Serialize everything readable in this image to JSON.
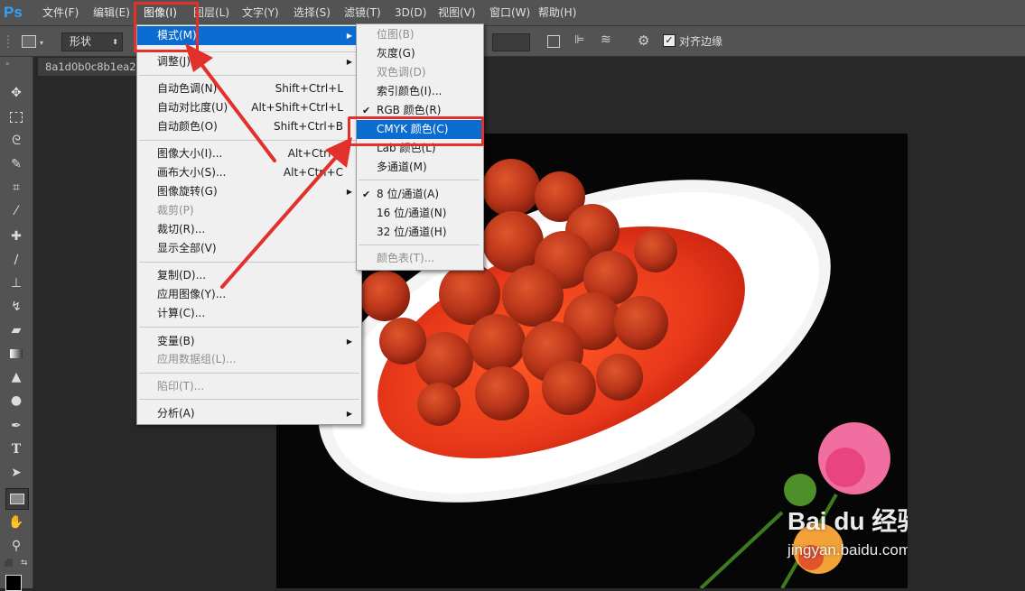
{
  "app": {
    "logo": "Ps"
  },
  "menubar": [
    "文件(F)",
    "编辑(E)",
    "图像(I)",
    "图层(L)",
    "文字(Y)",
    "选择(S)",
    "滤镜(T)",
    "3D(D)",
    "视图(V)",
    "窗口(W)",
    "帮助(H)"
  ],
  "options_bar": {
    "shape_mode": "形状",
    "align_edges_label": "对齐边缘",
    "align_edges_checked": true
  },
  "document_tab": {
    "title": "8a1d0b0c8b1ea24"
  },
  "image_menu": {
    "items": [
      {
        "label": "模式(M)",
        "shortcut": "",
        "submenu": true,
        "disabled": false,
        "highlighted": true
      },
      {
        "label": "调整(J)",
        "shortcut": "",
        "submenu": true,
        "disabled": false
      },
      {
        "label": "自动色调(N)",
        "shortcut": "Shift+Ctrl+L",
        "disabled": false
      },
      {
        "label": "自动对比度(U)",
        "shortcut": "Alt+Shift+Ctrl+L",
        "disabled": false
      },
      {
        "label": "自动颜色(O)",
        "shortcut": "Shift+Ctrl+B",
        "disabled": false
      },
      {
        "label": "图像大小(I)...",
        "shortcut": "Alt+Ctrl+I",
        "disabled": false
      },
      {
        "label": "画布大小(S)...",
        "shortcut": "Alt+Ctrl+C",
        "disabled": false
      },
      {
        "label": "图像旋转(G)",
        "shortcut": "",
        "submenu": true,
        "disabled": false
      },
      {
        "label": "裁剪(P)",
        "shortcut": "",
        "disabled": true
      },
      {
        "label": "裁切(R)...",
        "shortcut": "",
        "disabled": false
      },
      {
        "label": "显示全部(V)",
        "shortcut": "",
        "disabled": false
      },
      {
        "label": "复制(D)...",
        "shortcut": "",
        "disabled": false
      },
      {
        "label": "应用图像(Y)...",
        "shortcut": "",
        "disabled": false
      },
      {
        "label": "计算(C)...",
        "shortcut": "",
        "disabled": false
      },
      {
        "label": "变量(B)",
        "shortcut": "",
        "submenu": true,
        "disabled": false
      },
      {
        "label": "应用数据组(L)...",
        "shortcut": "",
        "disabled": true
      },
      {
        "label": "陷印(T)...",
        "shortcut": "",
        "disabled": true
      },
      {
        "label": "分析(A)",
        "shortcut": "",
        "submenu": true,
        "disabled": false
      }
    ]
  },
  "mode_submenu": {
    "items": [
      {
        "label": "位图(B)",
        "disabled": true,
        "checked": false
      },
      {
        "label": "灰度(G)",
        "disabled": false,
        "checked": false
      },
      {
        "label": "双色调(D)",
        "disabled": true,
        "checked": false
      },
      {
        "label": "索引颜色(I)...",
        "disabled": false,
        "checked": false
      },
      {
        "label": "RGB 颜色(R)",
        "disabled": false,
        "checked": true
      },
      {
        "label": "CMYK 颜色(C)",
        "disabled": false,
        "checked": false,
        "highlighted": true
      },
      {
        "label": "Lab 颜色(L)",
        "disabled": false,
        "checked": false
      },
      {
        "label": "多通道(M)",
        "disabled": false,
        "checked": false
      },
      {
        "label": "8 位/通道(A)",
        "disabled": false,
        "checked": true
      },
      {
        "label": "16 位/通道(N)",
        "disabled": false,
        "checked": false
      },
      {
        "label": "32 位/通道(H)",
        "disabled": false,
        "checked": false
      },
      {
        "label": "颜色表(T)...",
        "disabled": true,
        "checked": false
      }
    ]
  },
  "watermark": {
    "brand": "Bai du 经验",
    "url": "jingyan.baidu.com"
  },
  "colors": {
    "accent": "#0a6bd1",
    "annotation_red": "#e2302c",
    "sauce": "#e8381a"
  }
}
